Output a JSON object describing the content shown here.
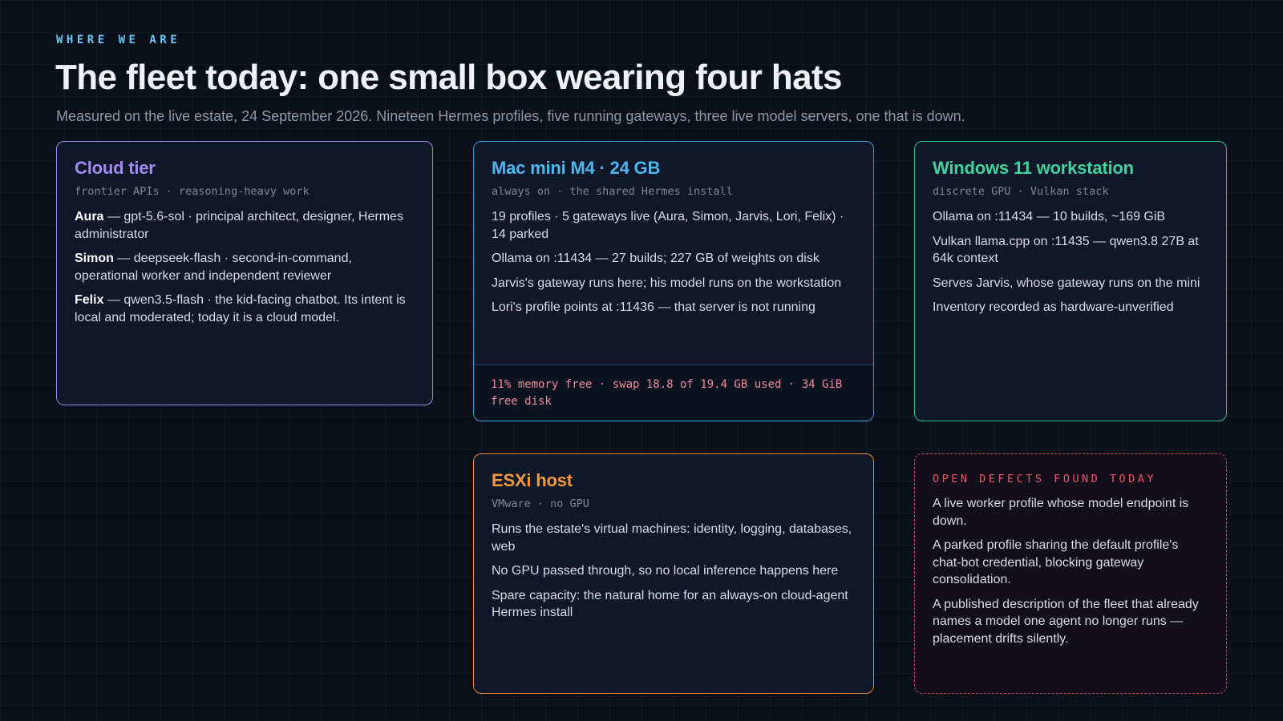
{
  "header": {
    "eyebrow": "WHERE WE ARE",
    "title": "The fleet today: one small box wearing four hats",
    "subtitle": "Measured on the live estate, 24 September 2026. Nineteen Hermes profiles, five running gateways, three live model servers, one that is down."
  },
  "cards": {
    "cloud": {
      "title": "Cloud tier",
      "meta": "frontier APIs · reasoning-heavy work",
      "items": [
        {
          "name": "Aura",
          "text": " — gpt-5.6-sol · principal architect, designer, Hermes administrator"
        },
        {
          "name": "Simon",
          "text": " — deepseek-flash · second-in-command, operational worker and independent reviewer"
        },
        {
          "name": "Felix",
          "text": " — qwen3.5-flash · the kid-facing chatbot. Its intent is local and moderated; today it is a cloud model."
        }
      ]
    },
    "mac": {
      "title": "Mac mini M4 · 24 GB",
      "meta": "always on · the shared Hermes install",
      "items": [
        "19 profiles · 5 gateways live (Aura, Simon, Jarvis, Lori, Felix) · 14 parked",
        "Ollama on :11434 — 27 builds; 227 GB of weights on disk",
        "Jarvis's gateway runs here; his model runs on the workstation",
        "Lori's profile points at :11436 — that server is not running"
      ],
      "footer": "11% memory free · swap 18.8 of 19.4 GB used · 34 GiB free disk"
    },
    "windows": {
      "title": "Windows 11 workstation",
      "meta": "discrete GPU · Vulkan stack",
      "items": [
        "Ollama on :11434 — 10 builds, ~169 GiB",
        "Vulkan llama.cpp on :11435 — qwen3.8 27B at 64k context",
        "Serves Jarvis, whose gateway runs on the mini",
        "Inventory recorded as hardware-unverified"
      ]
    },
    "esxi": {
      "title": "ESXi host",
      "meta": "VMware · no GPU",
      "items": [
        "Runs the estate's virtual machines: identity, logging, databases, web",
        "No GPU passed through, so no local inference happens here",
        "Spare capacity: the natural home for an always-on cloud-agent Hermes install"
      ]
    },
    "defects": {
      "heading": "OPEN DEFECTS FOUND TODAY",
      "items": [
        "A live worker profile whose model endpoint is down.",
        "A parked profile sharing the default profile's chat-bot credential, blocking gateway consolidation.",
        "A published description of the fleet that already names a model one agent no longer runs — placement drifts silently."
      ]
    }
  },
  "colors": {
    "cloud": "#a48af0",
    "mac": "#4cb8f0",
    "windows": "#3fd29a",
    "esxi": "#f39a3f",
    "defects": "#e4586a",
    "eyebrow": "#6cc4f5"
  }
}
